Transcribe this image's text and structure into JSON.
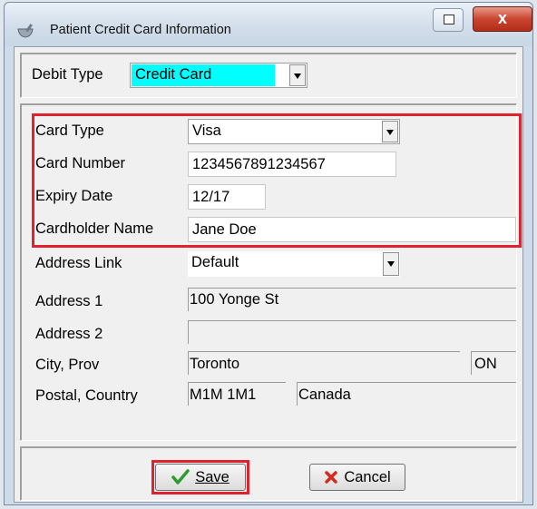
{
  "window": {
    "title": "Patient Credit Card Information",
    "close_glyph": "x",
    "icons": [
      "mortar-pestle-icon",
      "restore-icon",
      "close-icon"
    ]
  },
  "debit": {
    "label": "Debit Type",
    "value": "Credit Card",
    "highlight_color": "#00ffff"
  },
  "card": {
    "type_label": "Card Type",
    "type_value": "Visa",
    "number_label": "Card Number",
    "number_value": "1234567891234567",
    "expiry_label": "Expiry Date",
    "expiry_value": "12/17",
    "holder_label": "Cardholder Name",
    "holder_value": "Jane Doe"
  },
  "address": {
    "link_label": "Address Link",
    "link_value": "Default",
    "address1_label": "Address 1",
    "address1_value": "100 Yonge St",
    "address2_label": "Address 2",
    "address2_value": "",
    "city_prov_label": "City, Prov",
    "city_value": "Toronto",
    "prov_value": "ON",
    "postal_country_label": "Postal, Country",
    "postal_value": "M1M 1M1",
    "country_value": "Canada"
  },
  "actions": {
    "save_label": "Save",
    "cancel_label": "Cancel",
    "save_icon": "checkmark-icon",
    "cancel_icon": "x-icon"
  },
  "colors": {
    "highlight_border": "#e0212e",
    "save_check": "#2e9b2e",
    "cancel_x": "#d32b1e"
  }
}
